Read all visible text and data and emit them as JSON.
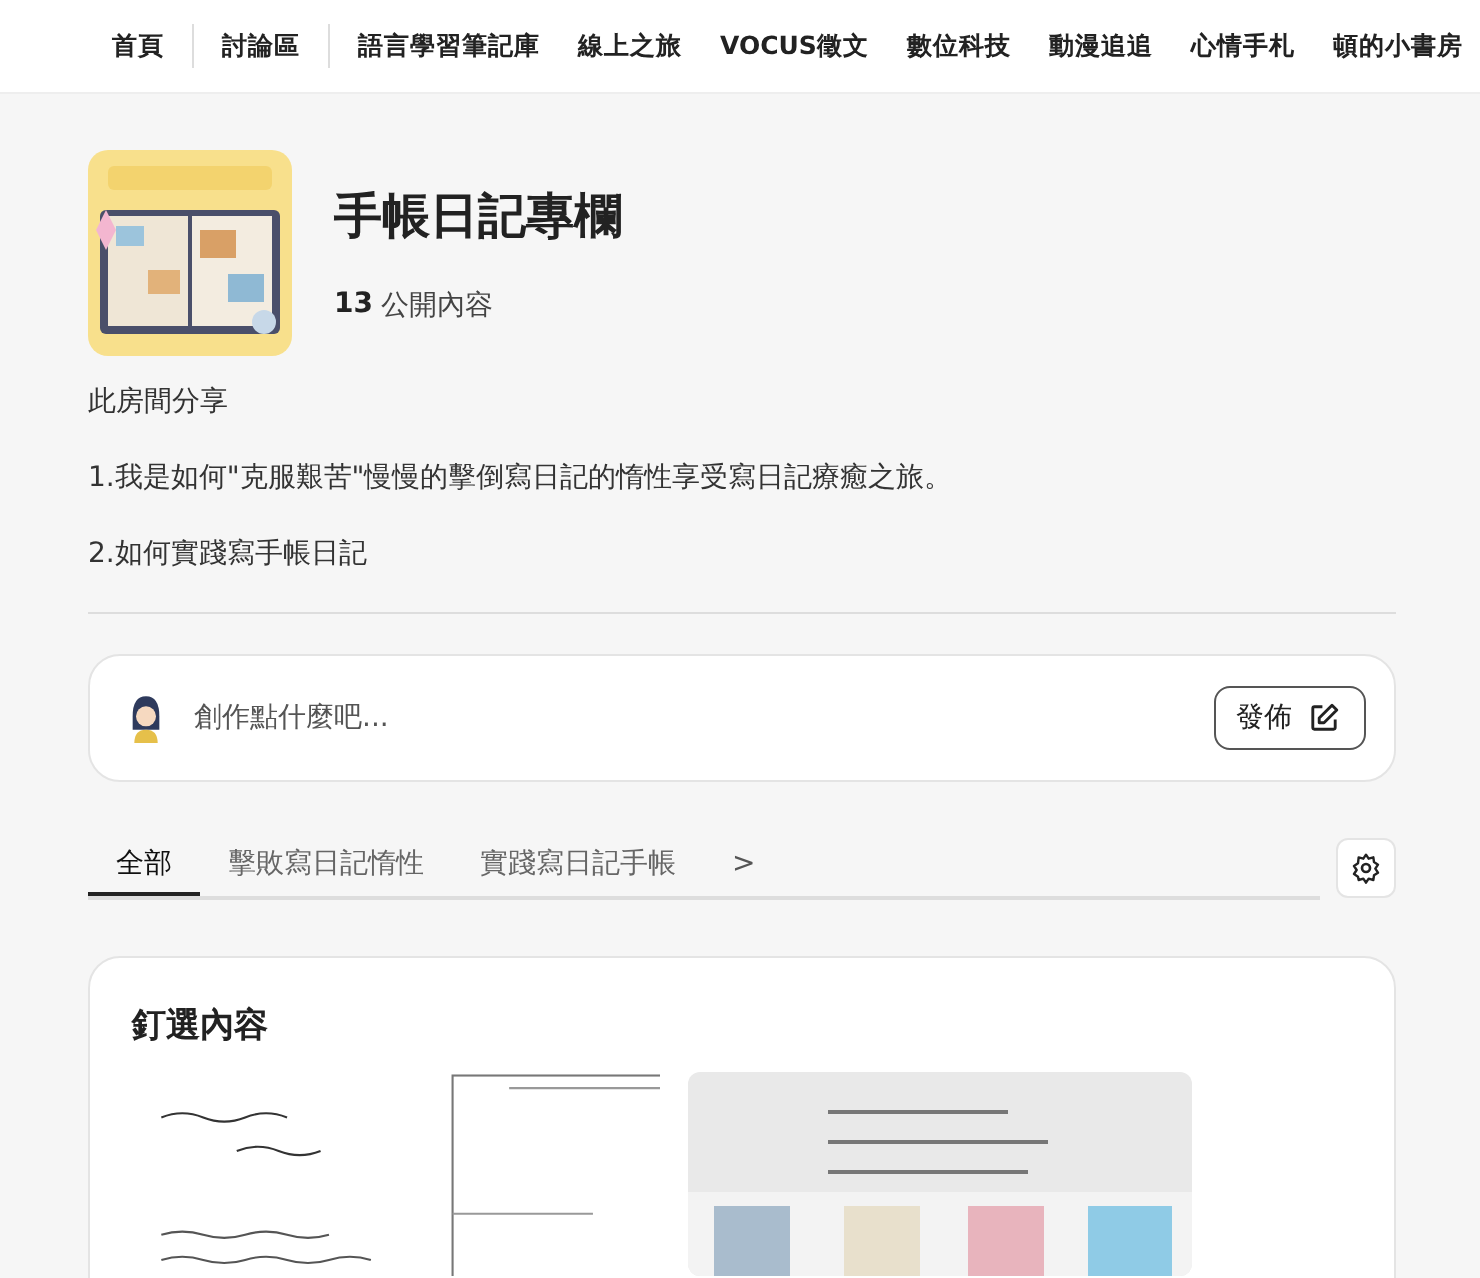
{
  "nav": [
    {
      "label": "首頁",
      "divider_after": true
    },
    {
      "label": "討論區",
      "divider_after": true
    },
    {
      "label": "語言學習筆記庫",
      "divider_after": false
    },
    {
      "label": "線上之旅",
      "divider_after": false
    },
    {
      "label": "VOCUS徵文",
      "divider_after": false
    },
    {
      "label": "數位科技",
      "divider_after": false
    },
    {
      "label": "動漫追追",
      "divider_after": false
    },
    {
      "label": "心情手札",
      "divider_after": false
    },
    {
      "label": "頓的小書房",
      "divider_after": false
    }
  ],
  "room": {
    "title": "手帳日記專欄",
    "count": "13",
    "count_label": "公開內容"
  },
  "description": [
    "此房間分享",
    "1.我是如何\"克服艱苦\"慢慢的擊倒寫日記的惰性享受寫日記療癒之旅。",
    "2.如何實踐寫手帳日記"
  ],
  "composer": {
    "placeholder": "創作點什麼吧...",
    "button": "發佈"
  },
  "tabs": [
    {
      "label": "全部",
      "selected": true
    },
    {
      "label": "擊敗寫日記惰性",
      "selected": false
    },
    {
      "label": "實踐寫日記手帳",
      "selected": false
    }
  ],
  "tabs_more": ">",
  "pinned": {
    "title": "釘選內容"
  }
}
